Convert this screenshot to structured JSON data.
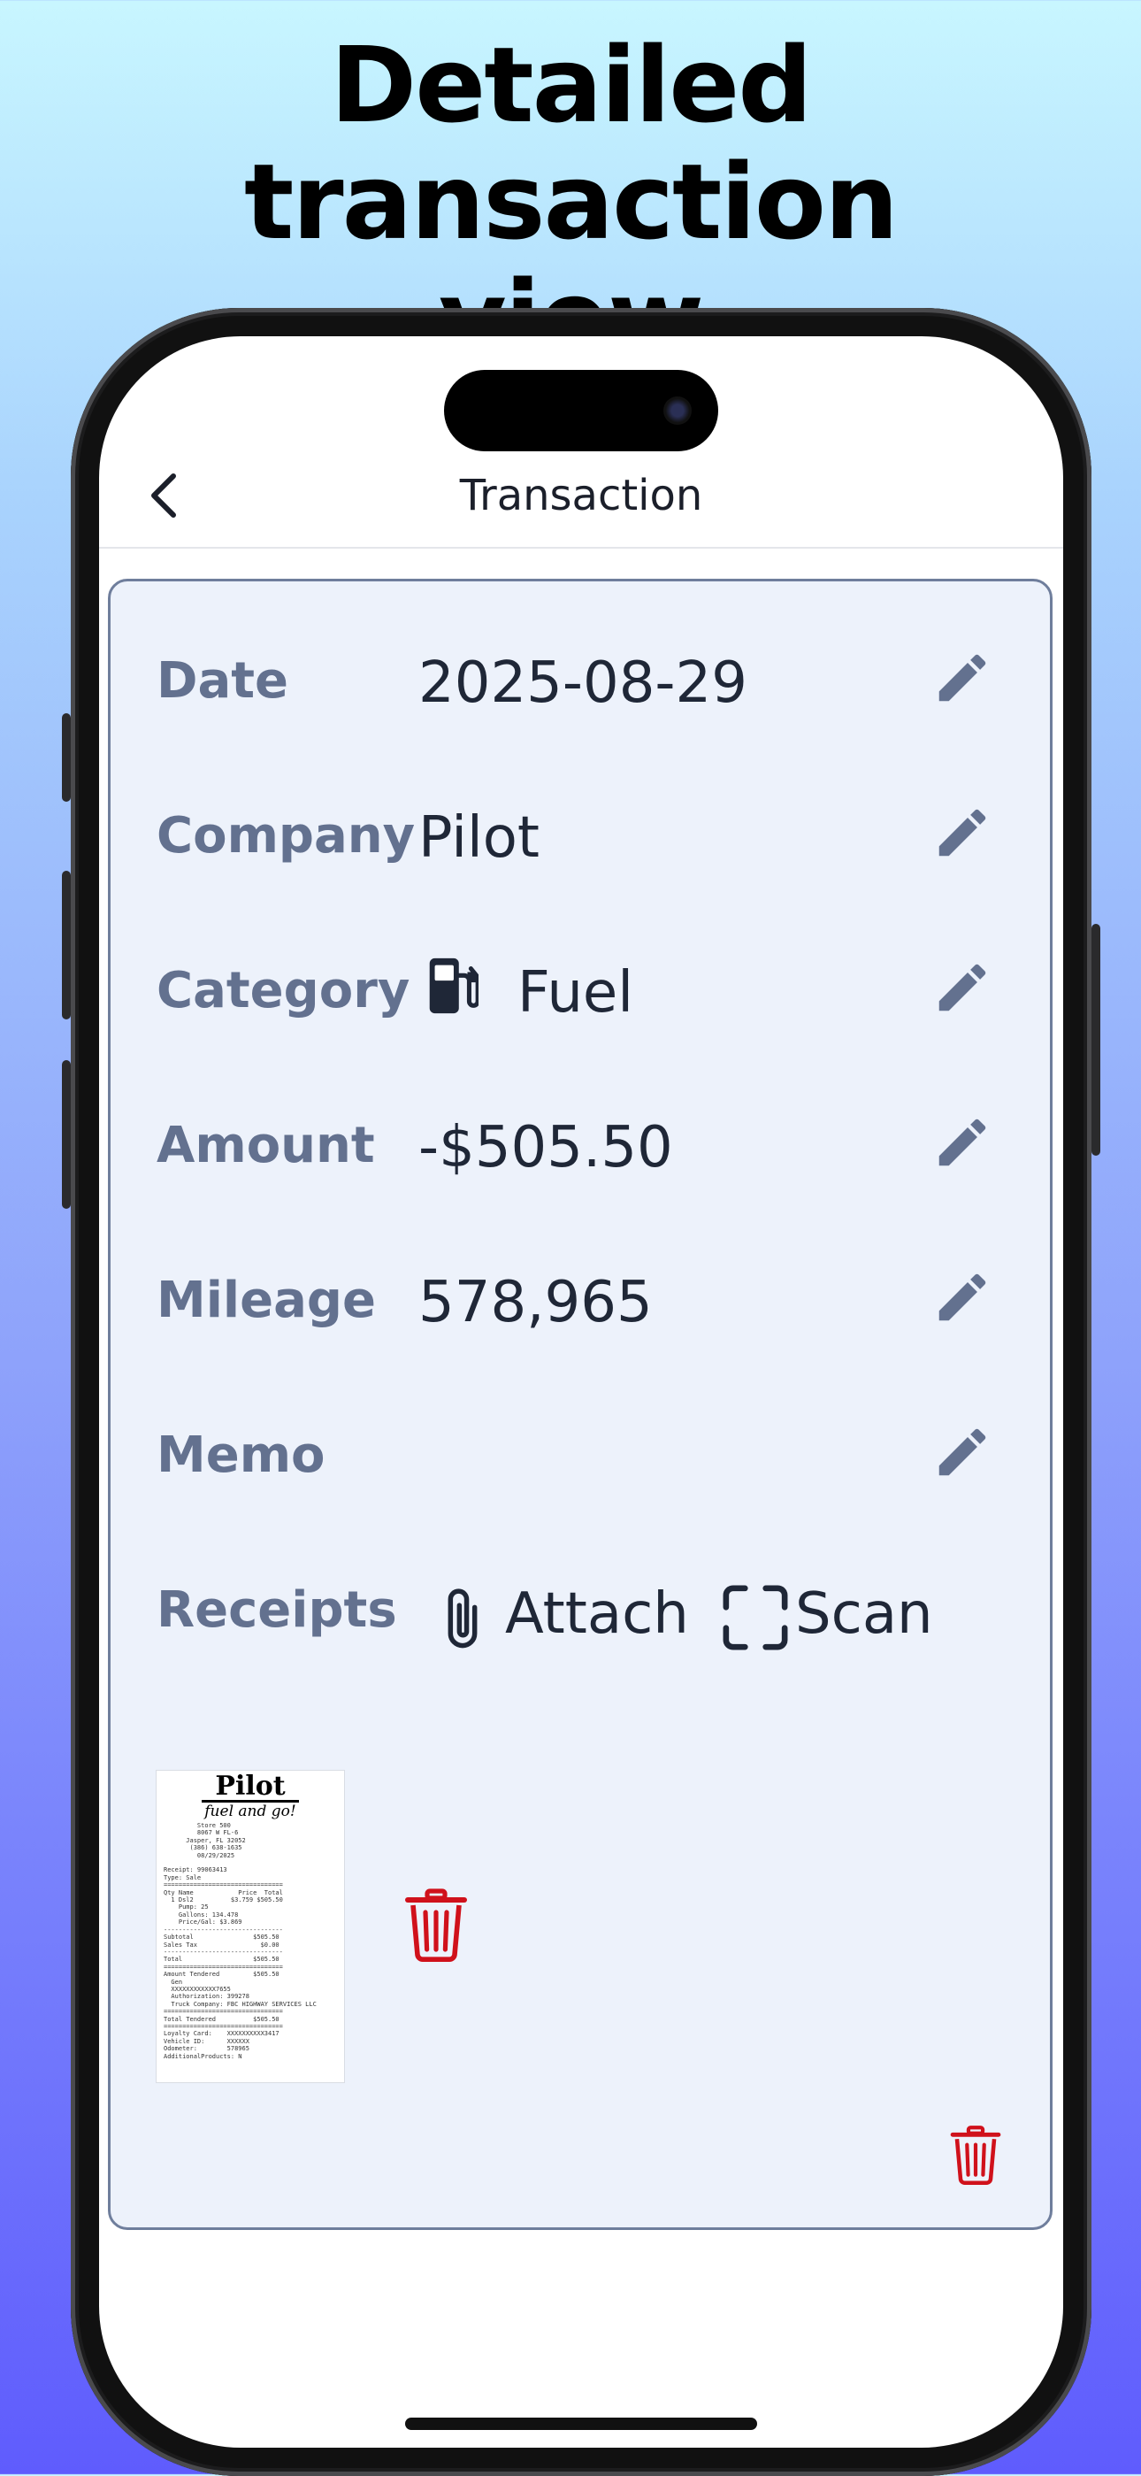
{
  "headline": {
    "line1": "Detailed transaction",
    "line2": "view"
  },
  "nav": {
    "title": "Transaction",
    "back_icon": "chevron-left-icon"
  },
  "fields": {
    "date": {
      "label": "Date",
      "value": "2025-08-29"
    },
    "company": {
      "label": "Company",
      "value": "Pilot"
    },
    "category": {
      "label": "Category",
      "value": "Fuel",
      "icon": "fuel-pump-icon"
    },
    "amount": {
      "label": "Amount",
      "value": "-$505.50"
    },
    "mileage": {
      "label": "Mileage",
      "value": "578,965"
    },
    "memo": {
      "label": "Memo",
      "value": ""
    }
  },
  "receipts": {
    "label": "Receipts",
    "attach_label": "Attach",
    "scan_label": "Scan",
    "thumbnail": {
      "brand": "Pilot",
      "slogan": "fuel and go!",
      "body": "         Store 500\n         8067 W FL-6\n      Jasper, FL 32052\n       (386) 638-1635\n         08/29/2025\n\nReceipt: 99063413\nType: Sale\n================================\nQty Name            Price  Total\n  1 Dsl2          $3.759 $505.50\n    Pump: 25\n    Gallons: 134.478\n    Price/Gal: $3.869\n--------------------------------\nSubtotal                $505.50\nSales Tax                 $0.00\n--------------------------------\nTotal                   $505.50\n================================\nAmount Tendered         $505.50\n  Gen\n  XXXXXXXXXXXX7655\n  Authorization: 399278\n  Truck Company: FBC HIGHWAY SERVICES LLC\n================================\nTotal Tendered          $505.50\n================================\nLoyalty Card:    XXXXXXXXXX3417\nVehicle ID:      XXXXXX\nOdometer:        578965\nAdditionalProducts: N"
    }
  },
  "colors": {
    "accent_label": "#63718f",
    "delete": "#d0111b",
    "card_bg": "#edf2fb"
  }
}
